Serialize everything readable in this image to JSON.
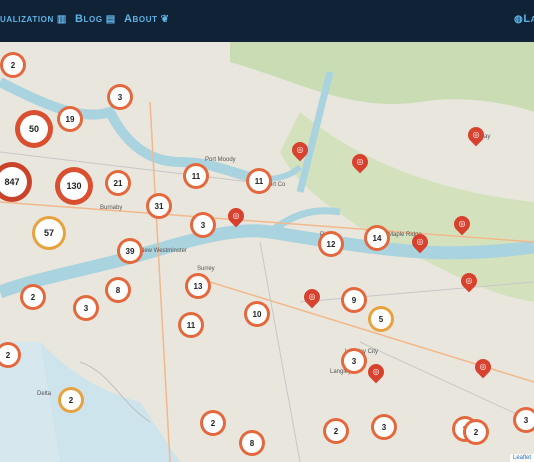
{
  "nav": {
    "visualization": "ualization",
    "blog": "Blog",
    "about": "About",
    "language": "La"
  },
  "icons": {
    "visualization": "bar-chart-icon",
    "blog": "newspaper-icon",
    "about": "leaf-icon",
    "language": "globe-icon",
    "bike": "bicycle-icon"
  },
  "colors": {
    "topbar": "#0f2236",
    "nav_text": "#5fb3e5",
    "cluster_ring": "#e4683d",
    "pin": "#d9412f",
    "water": "#a9d3df",
    "land": "#e8e5dc"
  },
  "place_labels": [
    "Port Moody",
    "Port Co",
    "Burnaby",
    "New Westminster",
    "Surrey",
    "Langley City",
    "Langley",
    "Delta",
    "Pitt M",
    "Maple Ridge",
    "Bay"
  ],
  "clusters": [
    "2",
    "3",
    "19",
    "50",
    "847",
    "130",
    "21",
    "11",
    "11",
    "31",
    "3",
    "57",
    "39",
    "12",
    "14",
    "8",
    "13",
    "2",
    "3",
    "10",
    "9",
    "5",
    "11",
    "2",
    "3",
    "2",
    "2",
    "2",
    "8",
    "2",
    "3",
    "2",
    "3"
  ],
  "attribution": "Leaflet"
}
